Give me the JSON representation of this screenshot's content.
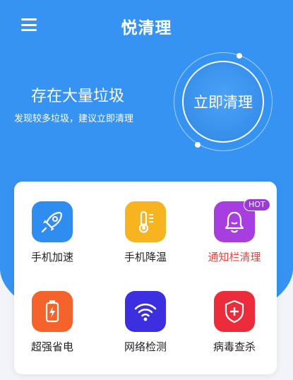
{
  "header": {
    "title": "悦清理",
    "menu_icon": "hamburger-menu-icon"
  },
  "hero": {
    "headline": "存在大量垃圾",
    "subline": "发现较多垃圾，建议立即清理",
    "clean_button": "立即清理"
  },
  "tools": [
    {
      "label": "手机加速",
      "icon": "rocket-icon",
      "color": "#2f8cf0"
    },
    {
      "label": "手机降温",
      "icon": "thermometer-icon",
      "color": "#f7b320"
    },
    {
      "label": "通知栏清理",
      "icon": "bell-icon",
      "color": "#a63ee0",
      "badge": "HOT",
      "label_color": "#e8453c"
    },
    {
      "label": "超强省电",
      "icon": "battery-icon",
      "color": "#f5632a"
    },
    {
      "label": "网络检测",
      "icon": "wifi-icon",
      "color": "#3b2fe0"
    },
    {
      "label": "病毒查杀",
      "icon": "shield-icon",
      "color": "#ec2c3a"
    }
  ],
  "colors": {
    "primary": "#3793f2",
    "background": "#f2f4f8"
  }
}
